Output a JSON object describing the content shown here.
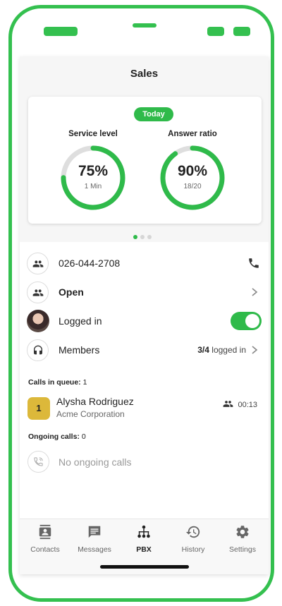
{
  "header": {
    "title": "Sales"
  },
  "stats": {
    "badge": "Today",
    "service_level": {
      "label": "Service level",
      "value": "75%",
      "sub": "1 Min",
      "fraction": 0.75
    },
    "answer_ratio": {
      "label": "Answer ratio",
      "value": "90%",
      "sub": "18/20",
      "fraction": 0.9
    },
    "pager": {
      "pages": 3,
      "active": 0
    }
  },
  "queue_rows": {
    "phone": "026-044-2708",
    "status": "Open",
    "login": {
      "label": "Logged in",
      "toggle_on": true
    },
    "members": {
      "label": "Members",
      "count": "3/4",
      "count_suffix": "logged in"
    }
  },
  "calls_in_queue": {
    "label": "Calls in queue:",
    "count": "1",
    "items": [
      {
        "position": "1",
        "name": "Alysha Rodriguez",
        "company": "Acme Corporation",
        "wait": "00:13"
      }
    ]
  },
  "ongoing_calls": {
    "label": "Ongoing calls:",
    "count": "0",
    "empty_text": "No ongoing calls"
  },
  "tabs": [
    {
      "label": "Contacts",
      "icon": "contacts-icon"
    },
    {
      "label": "Messages",
      "icon": "messages-icon"
    },
    {
      "label": "PBX",
      "icon": "pbx-icon",
      "active": true
    },
    {
      "label": "History",
      "icon": "history-icon"
    },
    {
      "label": "Settings",
      "icon": "settings-icon"
    }
  ],
  "colors": {
    "accent": "#2fba4a",
    "frame": "#34c04f",
    "queue_badge": "#dcb83a",
    "ring_track": "#dedede"
  }
}
